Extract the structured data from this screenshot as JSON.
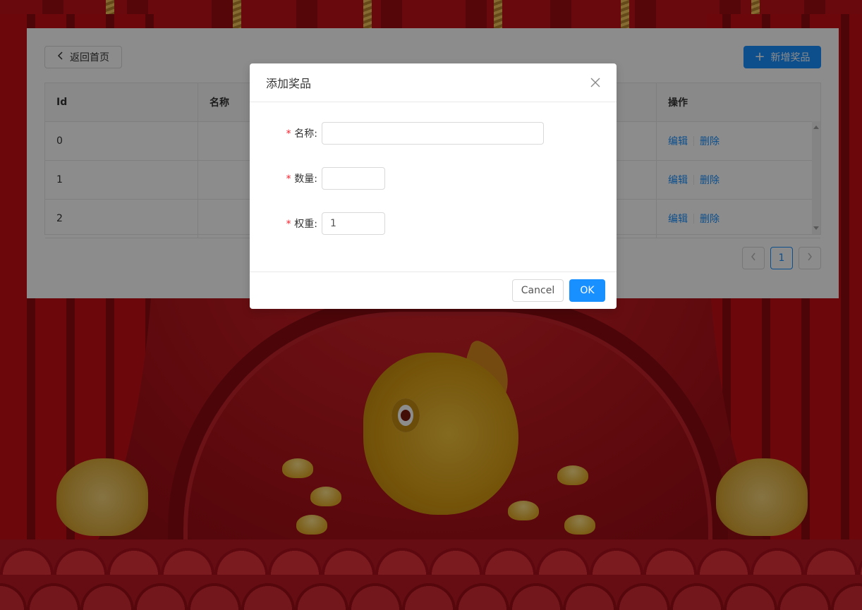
{
  "panel": {
    "back_label": "返回首页",
    "add_label": "新增奖品"
  },
  "table": {
    "headers": [
      "Id",
      "名称",
      "操作"
    ],
    "rows": [
      {
        "id": "0",
        "name": "",
        "edit": "编辑",
        "delete": "删除"
      },
      {
        "id": "1",
        "name": "",
        "edit": "编辑",
        "delete": "删除"
      },
      {
        "id": "2",
        "name": "",
        "edit": "编辑",
        "delete": "删除"
      }
    ]
  },
  "pagination": {
    "current": "1",
    "prev_icon": "chevron-left-icon",
    "next_icon": "chevron-right-icon"
  },
  "modal": {
    "title": "添加奖品",
    "fields": {
      "name": {
        "label": "名称:",
        "value": ""
      },
      "quantity": {
        "label": "数量:",
        "value": ""
      },
      "weight": {
        "label": "权重:",
        "value": "1"
      }
    },
    "required_mark": "*",
    "cancel_label": "Cancel",
    "ok_label": "OK"
  },
  "colors": {
    "primary": "#1890ff",
    "required": "#f5222d"
  }
}
